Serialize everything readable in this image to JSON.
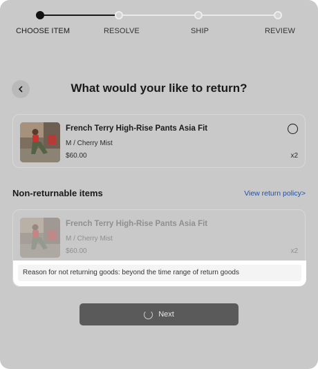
{
  "stepper": {
    "steps": [
      {
        "label": "CHOOSE ITEM",
        "state": "active"
      },
      {
        "label": "RESOLVE",
        "state": "pending"
      },
      {
        "label": "SHIP",
        "state": "pending"
      },
      {
        "label": "REVIEW",
        "state": "pending"
      }
    ]
  },
  "header": {
    "back_icon": "chevron-left-icon",
    "title": "What would your like to return?"
  },
  "returnable_item": {
    "name": "French Terry High-Rise Pants Asia Fit",
    "variant": "M / Cherry Mist",
    "price": "$60.00",
    "quantity": "x2",
    "selected": false
  },
  "non_returnable": {
    "title": "Non-returnable items",
    "policy_link": "View return policy>",
    "item": {
      "name": "French Terry High-Rise Pants Asia Fit",
      "variant": "M / Cherry Mist",
      "price": "$60.00",
      "quantity": "x2",
      "reason": "Reason for not returning goods: beyond the time range of return goods"
    }
  },
  "footer": {
    "next_label": "Next",
    "loading_icon": "spinner-icon"
  },
  "colors": {
    "overlay": "#c9c9c9",
    "link": "#1e4fa8",
    "button": "#5a5a5a"
  }
}
